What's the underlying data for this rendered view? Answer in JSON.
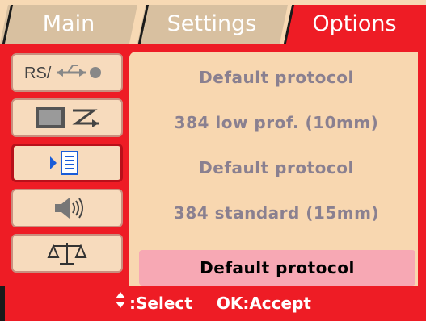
{
  "tabs": {
    "main": "Main",
    "settings": "Settings",
    "options": "Options"
  },
  "sidebar": {
    "items": [
      {
        "icon": "rs232-usb-icon",
        "label": "RS/"
      },
      {
        "icon": "monitor-arrow-icon"
      },
      {
        "icon": "protocol-list-icon",
        "selected": true
      },
      {
        "icon": "speaker-icon"
      },
      {
        "icon": "balance-scale-icon"
      }
    ]
  },
  "protocols": [
    {
      "label": "Default protocol"
    },
    {
      "label": "384 low prof. (10mm)"
    },
    {
      "label": "Default protocol"
    },
    {
      "label": "384 standard (15mm)"
    },
    {
      "label": "Default protocol",
      "selected": true
    }
  ],
  "footer": {
    "select_label": ":Select",
    "accept_label": "OK:Accept"
  },
  "colors": {
    "accent": "#ee1c25",
    "panel": "#f8d7b0",
    "highlight": "#f7a8b4"
  }
}
